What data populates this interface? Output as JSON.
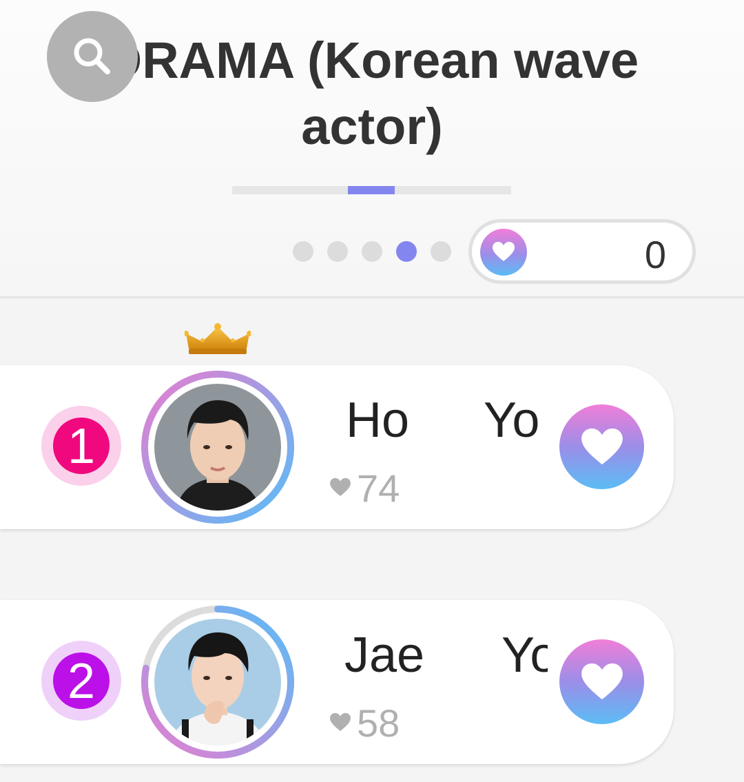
{
  "header": {
    "title": "DRAMA (Korean wave actor)",
    "progress": {
      "value": 0.5
    },
    "page_dots": {
      "count": 5,
      "active_index": 3
    },
    "heart_balance": "0"
  },
  "colors": {
    "accent": "#8486f0",
    "rank1": "#f0087e",
    "rank2": "#bb10e8",
    "gradient_top": "#f07ed8",
    "gradient_bottom": "#5bbcf5"
  },
  "ranking": [
    {
      "rank": "1",
      "name_first": "Ho",
      "name_last": "Yo",
      "votes": "74",
      "has_crown": true,
      "ring_progress": 1.0
    },
    {
      "rank": "2",
      "name_first": "Jae",
      "name_last": "Yo",
      "votes": "58",
      "has_crown": false,
      "ring_progress": 0.78
    }
  ],
  "icons": [
    "search-icon",
    "heart-icon",
    "crown-icon"
  ]
}
